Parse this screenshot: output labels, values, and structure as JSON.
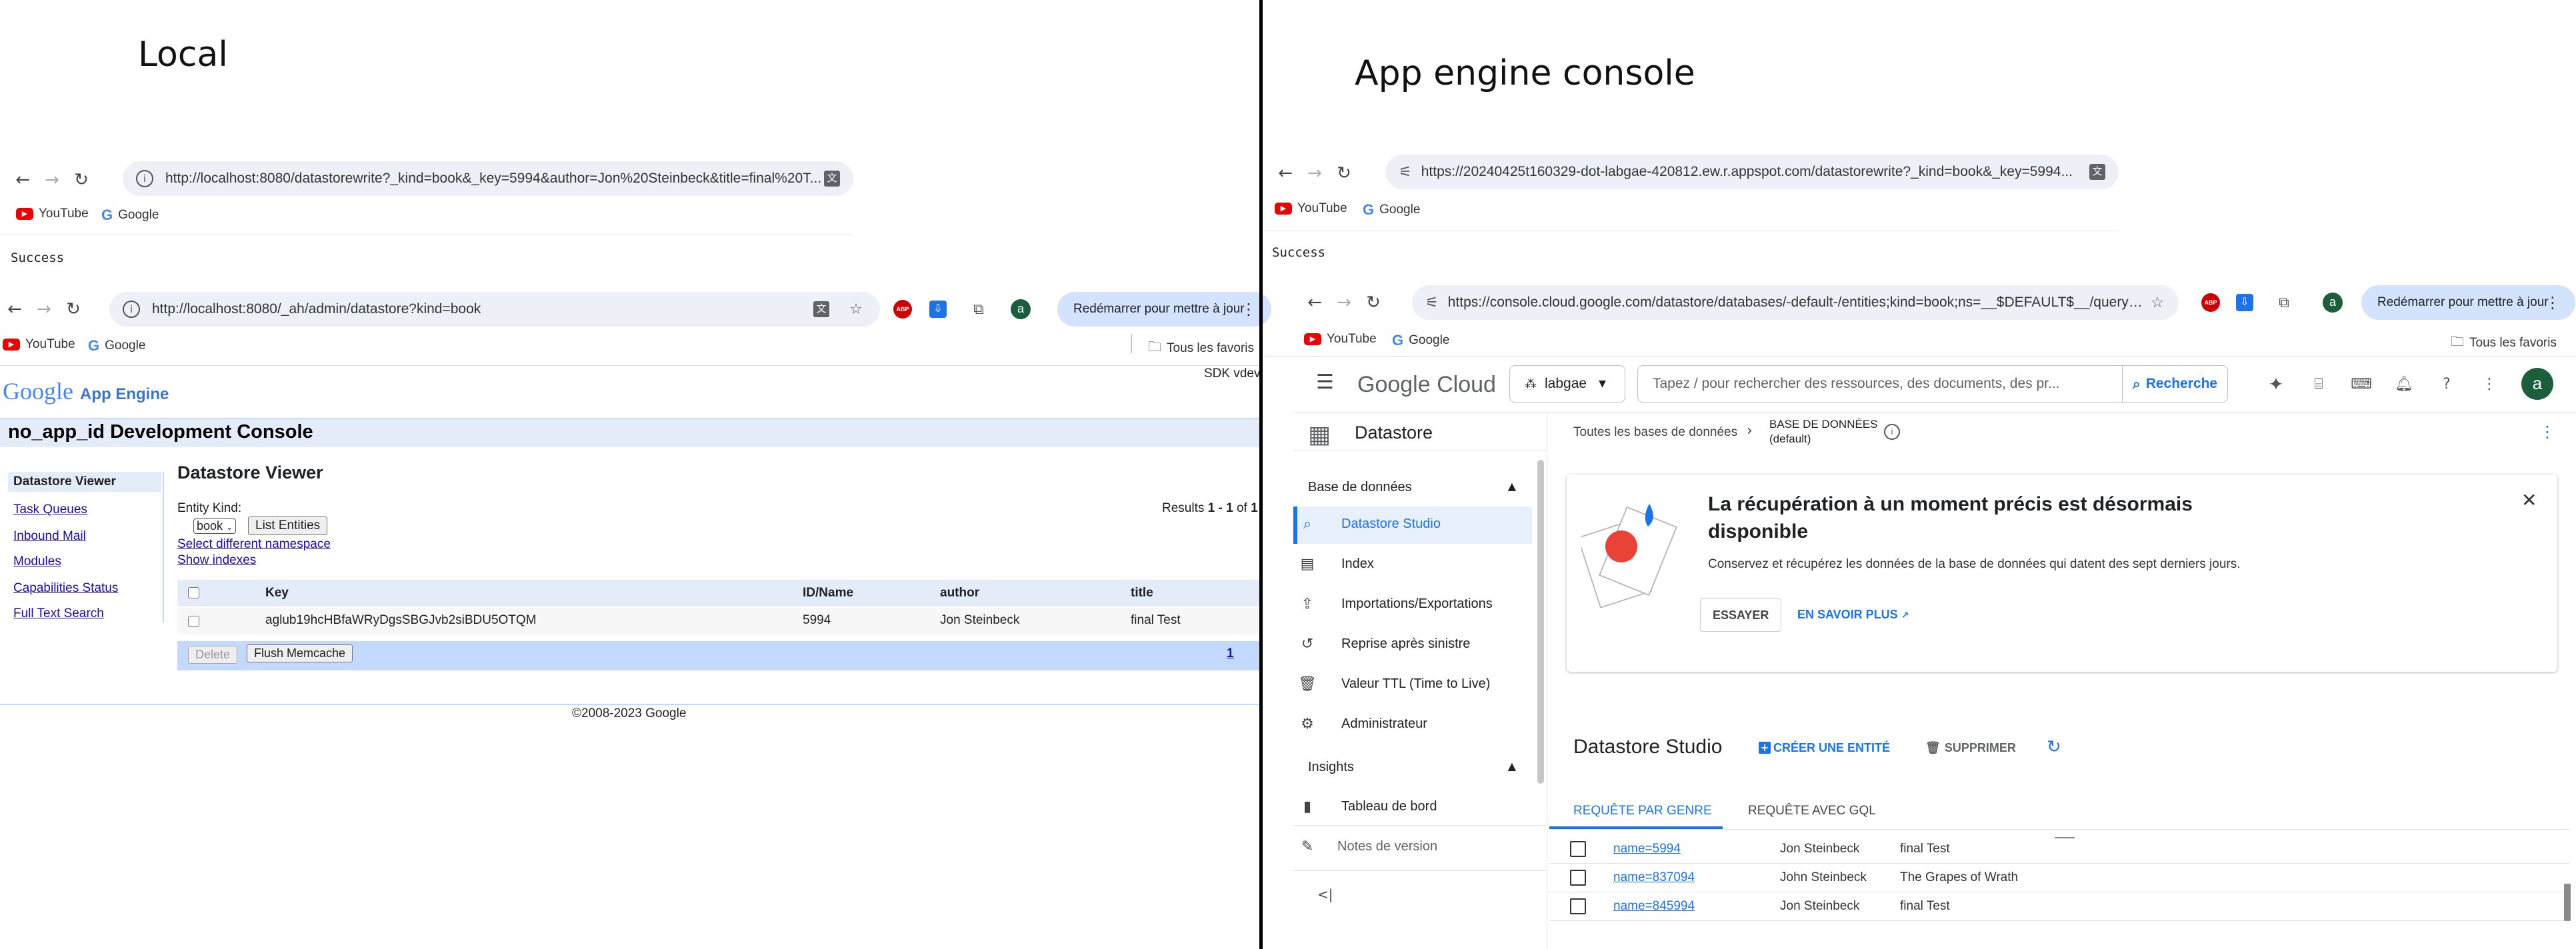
{
  "left": {
    "heading": "Local",
    "browser1": {
      "url": "http://localhost:8080/datastorewrite?_kind=book&_key=5994&author=Jon%20Steinbeck&title=final%20T...",
      "bookmarks": [
        "YouTube",
        "Google"
      ],
      "page_text": "Success"
    },
    "browser2": {
      "url": "http://localhost:8080/_ah/admin/datastore?kind=book",
      "update_button": "Redémarrer pour mettre à jour",
      "bookmarks": [
        "YouTube",
        "Google"
      ],
      "all_bookmarks": "Tous les favoris"
    },
    "devconsole": {
      "logo_google": "Google",
      "logo_product": "App Engine",
      "sdk_version": "SDK vdev",
      "title": "no_app_id Development Console",
      "nav": [
        "Datastore Viewer",
        "Task Queues",
        "Inbound Mail",
        "Modules",
        "Capabilities Status",
        "Full Text Search"
      ],
      "viewer_title": "Datastore Viewer",
      "entity_kind_label": "Entity Kind:",
      "kind_select": "book",
      "list_button": "List Entities",
      "namespace_link": "Select different namespace",
      "indexes_link": "Show indexes",
      "results_prefix": "Results",
      "results_range": "1 - 1",
      "results_of": "of",
      "results_total": "1",
      "columns": [
        "Key",
        "ID/Name",
        "author",
        "title"
      ],
      "rows": [
        {
          "key": "aglub19hcHBfaWRyDgsSBGJvb2siBDU5OTQM",
          "id": "5994",
          "author": "Jon Steinbeck",
          "title": "final Test"
        }
      ],
      "delete_button": "Delete",
      "flush_button": "Flush Memcache",
      "page_link": "1",
      "footer": "©2008-2023 Google"
    }
  },
  "right": {
    "heading": "App engine console",
    "browser1": {
      "url": "https://20240425t160329-dot-labgae-420812.ew.r.appspot.com/datastorewrite?_kind=book&_key=5994...",
      "bookmarks": [
        "YouTube",
        "Google"
      ],
      "page_text": "Success"
    },
    "browser2": {
      "url": "https://console.cloud.google.com/datastore/databases/-default-/entities;kind=book;ns=__$DEFAULT$__/query/...",
      "update_button": "Redémarrer pour mettre à jour",
      "bookmarks": [
        "YouTube",
        "Google"
      ],
      "all_bookmarks": "Tous les favoris"
    },
    "cloud": {
      "logo": "Google Cloud",
      "project": "labgae",
      "search_placeholder": "Tapez / pour rechercher des ressources, des documents, des pr...",
      "search_button": "Recherche",
      "product": "Datastore",
      "crumb_all": "Toutes les bases de données",
      "crumb_db_label": "BASE DE DONNÉES",
      "crumb_db_name": "(default)",
      "section_db": "Base de données",
      "nav": [
        "Datastore Studio",
        "Index",
        "Importations/Exportations",
        "Reprise après sinistre",
        "Valeur TTL (Time to Live)",
        "Administrateur"
      ],
      "section_insights": "Insights",
      "nav_insights": [
        "Tableau de bord"
      ],
      "release_notes": "Notes de version",
      "banner_title": "La récupération à un moment précis est désormais disponible",
      "banner_text": "Conservez et récupérez les données de la base de données qui datent des sept derniers jours.",
      "try_button": "ESSAYER",
      "learn_more": "EN SAVOIR PLUS",
      "studio_title": "Datastore Studio",
      "create_entity": "CRÉER UNE ENTITÉ",
      "delete": "SUPPRIMER",
      "tab_kind": "REQUÊTE PAR GENRE",
      "tab_gql": "REQUÊTE AVEC GQL",
      "rows": [
        {
          "name": "name=5994",
          "author": "Jon Steinbeck",
          "title": "final Test"
        },
        {
          "name": "name=837094",
          "author": "John Steinbeck",
          "title": "The Grapes of Wrath"
        },
        {
          "name": "name=845994",
          "author": "Jon Steinbeck",
          "title": "final Test"
        }
      ]
    }
  },
  "icons": {
    "back": "←",
    "forward": "→",
    "reload": "↻",
    "star": "☆",
    "gear": "⚙",
    "search": "⌕",
    "close": "✕"
  },
  "colors": {
    "accent": "#1a73e8",
    "dev_header_bg": "#e5ecf9",
    "dev_footer_bg": "#c3d9ff",
    "cloud_active_bg": "#e8f0fe"
  }
}
